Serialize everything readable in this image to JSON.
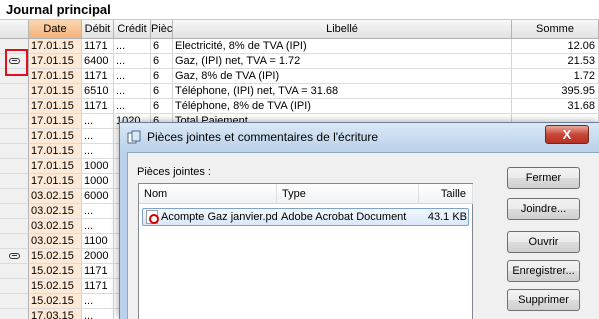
{
  "journal": {
    "title": "Journal principal",
    "columns": [
      "Date",
      "Débit",
      "Crédit",
      "Pièce",
      "Libellé",
      "Somme"
    ],
    "rows": [
      {
        "date": "17.01.15",
        "debit": "1171",
        "credit": "...",
        "piece": "6",
        "libelle": "Electricité, 8% de TVA (IPI)",
        "somme": "12.06",
        "attachment": false
      },
      {
        "date": "17.01.15",
        "debit": "6400",
        "credit": "...",
        "piece": "6",
        "libelle": "Gaz, (IPI) net, TVA = 1.72",
        "somme": "21.53",
        "attachment": true
      },
      {
        "date": "17.01.15",
        "debit": "1171",
        "credit": "...",
        "piece": "6",
        "libelle": "Gaz, 8% de TVA (IPI)",
        "somme": "1.72",
        "attachment": false
      },
      {
        "date": "17.01.15",
        "debit": "6510",
        "credit": "...",
        "piece": "6",
        "libelle": "Téléphone, (IPI) net, TVA = 31.68",
        "somme": "395.95",
        "attachment": false
      },
      {
        "date": "17.01.15",
        "debit": "1171",
        "credit": "...",
        "piece": "6",
        "libelle": "Téléphone, 8% de TVA (IPI)",
        "somme": "31.68",
        "attachment": false
      },
      {
        "date": "17.01.15",
        "debit": "...",
        "credit": "1020",
        "piece": "6",
        "libelle": "Total Paiement",
        "somme": "",
        "attachment": false
      },
      {
        "date": "17.01.15",
        "debit": "...",
        "credit": "",
        "piece": "",
        "libelle": "",
        "somme": "",
        "attachment": false
      },
      {
        "date": "17.01.15",
        "debit": "...",
        "credit": "",
        "piece": "",
        "libelle": "",
        "somme": "",
        "attachment": false
      },
      {
        "date": "17.01.15",
        "debit": "1000",
        "credit": "",
        "piece": "",
        "libelle": "",
        "somme": "",
        "attachment": false
      },
      {
        "date": "17.01.15",
        "debit": "1000",
        "credit": "",
        "piece": "",
        "libelle": "",
        "somme": "",
        "attachment": false
      },
      {
        "date": "03.02.15",
        "debit": "6000",
        "credit": "",
        "piece": "",
        "libelle": "",
        "somme": "",
        "attachment": false
      },
      {
        "date": "03.02.15",
        "debit": "...",
        "credit": "",
        "piece": "",
        "libelle": "",
        "somme": "",
        "attachment": false
      },
      {
        "date": "03.02.15",
        "debit": "...",
        "credit": "",
        "piece": "",
        "libelle": "",
        "somme": "",
        "attachment": false
      },
      {
        "date": "03.02.15",
        "debit": "1100",
        "credit": "",
        "piece": "",
        "libelle": "",
        "somme": "",
        "attachment": false
      },
      {
        "date": "15.02.15",
        "debit": "2000",
        "credit": "",
        "piece": "",
        "libelle": "",
        "somme": "",
        "attachment": true
      },
      {
        "date": "15.02.15",
        "debit": "1171",
        "credit": "",
        "piece": "",
        "libelle": "",
        "somme": "",
        "attachment": false
      },
      {
        "date": "15.02.15",
        "debit": "1171",
        "credit": "",
        "piece": "",
        "libelle": "",
        "somme": "",
        "attachment": false
      },
      {
        "date": "15.02.15",
        "debit": "...",
        "credit": "",
        "piece": "",
        "libelle": "",
        "somme": "",
        "attachment": false
      },
      {
        "date": "17.03.15",
        "debit": "...",
        "credit": "",
        "piece": "",
        "libelle": "",
        "somme": "",
        "attachment": false
      }
    ]
  },
  "dialog": {
    "title": "Pièces jointes et commentaires de l'écriture",
    "close_label": "X",
    "attachments_label": "Pièces jointes :",
    "list_columns": {
      "name": "Nom",
      "type": "Type",
      "size": "Taille"
    },
    "files": [
      {
        "name": "Acompte Gaz janvier.pdf",
        "type": "Adobe Acrobat Document",
        "size": "43.1 KB"
      }
    ],
    "buttons": {
      "close": "Fermer",
      "attach": "Joindre...",
      "open": "Ouvrir",
      "save": "Enregistrer...",
      "delete": "Supprimer"
    }
  },
  "colors": {
    "date_header": "#f4b37a",
    "date_cell": "#fde9d6",
    "highlight": "#e0101c",
    "dialog_frame": "#b9d1ea",
    "close_button": "#c8463a"
  },
  "icons": {
    "attachment": "paperclip-icon",
    "pdf": "pdf-file-icon",
    "dialog": "attachment-window-icon"
  }
}
